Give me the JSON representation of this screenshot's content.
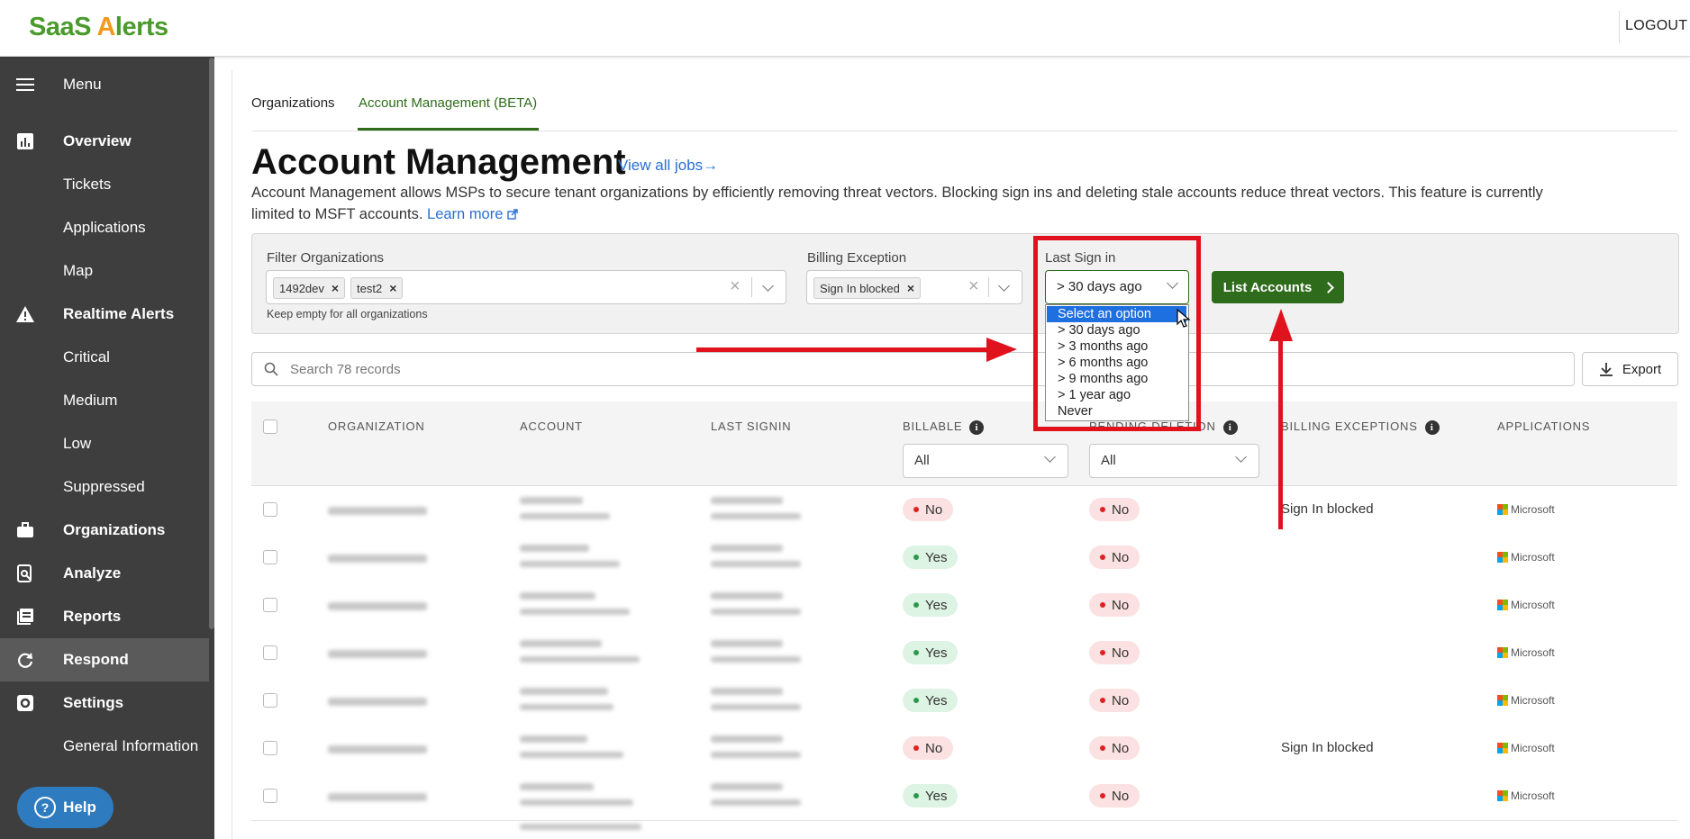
{
  "header": {
    "logo_text_a": "SaaS ",
    "logo_text_b": "A",
    "logo_text_c": "lerts",
    "logout": "LOGOUT"
  },
  "sidebar": {
    "items": [
      {
        "label": "Menu",
        "icon": "hamburger-icon"
      },
      {
        "label": "Overview",
        "icon": "chart-icon"
      },
      {
        "label": "Tickets"
      },
      {
        "label": "Applications"
      },
      {
        "label": "Map"
      },
      {
        "label": "Realtime Alerts",
        "icon": "warning-icon"
      },
      {
        "label": "Critical"
      },
      {
        "label": "Medium"
      },
      {
        "label": "Low"
      },
      {
        "label": "Suppressed"
      },
      {
        "label": "Organizations",
        "icon": "briefcase-icon"
      },
      {
        "label": "Analyze",
        "icon": "analyze-icon"
      },
      {
        "label": "Reports",
        "icon": "reports-icon"
      },
      {
        "label": "Respond",
        "icon": "refresh-icon",
        "active": true
      },
      {
        "label": "Settings",
        "icon": "gear-icon"
      },
      {
        "label": "General Information"
      }
    ],
    "help": "Help"
  },
  "tabs": [
    {
      "label": "Organizations"
    },
    {
      "label": "Account Management (BETA)",
      "active": true
    }
  ],
  "page": {
    "title": "Account Management",
    "view_jobs": "View all jobs→",
    "desc_line1": "Account Management allows MSPs to secure tenant organizations by efficiently removing threat vectors. Blocking sign ins and deleting stale accounts reduce threat vectors. This feature is currently",
    "desc_line2": "limited to MSFT accounts.",
    "learn_more": "Learn more"
  },
  "filters": {
    "org_label": "Filter Organizations",
    "org_chips": [
      "1492dev",
      "test2"
    ],
    "org_hint": "Keep empty for all organizations",
    "billing_label": "Billing Exception",
    "billing_chips": [
      "Sign In blocked"
    ],
    "last_label": "Last Sign in",
    "last_value": "> 30 days ago",
    "last_options": [
      "Select an option",
      "> 30 days ago",
      "> 3 months ago",
      "> 6 months ago",
      "> 9 months ago",
      "> 1 year ago",
      "Never"
    ],
    "list_button": "List Accounts"
  },
  "search": {
    "placeholder": "Search 78 records",
    "export": "Export"
  },
  "table": {
    "columns": [
      "ORGANIZATION",
      "ACCOUNT",
      "LAST SIGNIN",
      "BILLABLE",
      "PENDING DELETION",
      "BILLING EXCEPTIONS",
      "APPLICATIONS"
    ],
    "billable_filter": "All",
    "pending_filter": "All",
    "rows": [
      {
        "billable": "No",
        "pending": "No",
        "exception": "Sign In blocked",
        "app": "Microsoft"
      },
      {
        "billable": "Yes",
        "pending": "No",
        "exception": "",
        "app": "Microsoft"
      },
      {
        "billable": "Yes",
        "pending": "No",
        "exception": "",
        "app": "Microsoft"
      },
      {
        "billable": "Yes",
        "pending": "No",
        "exception": "",
        "app": "Microsoft"
      },
      {
        "billable": "Yes",
        "pending": "No",
        "exception": "",
        "app": "Microsoft"
      },
      {
        "billable": "No",
        "pending": "No",
        "exception": "Sign In blocked",
        "app": "Microsoft"
      },
      {
        "billable": "Yes",
        "pending": "No",
        "exception": "",
        "app": "Microsoft"
      }
    ]
  },
  "colors": {
    "brand_green": "#2e6b1a",
    "logo_green": "#4a9a2c",
    "logo_orange": "#f29a1d",
    "link_blue": "#2b6fd1",
    "annotation_red": "#e0121e",
    "sidebar_bg": "#3e3e3e"
  }
}
